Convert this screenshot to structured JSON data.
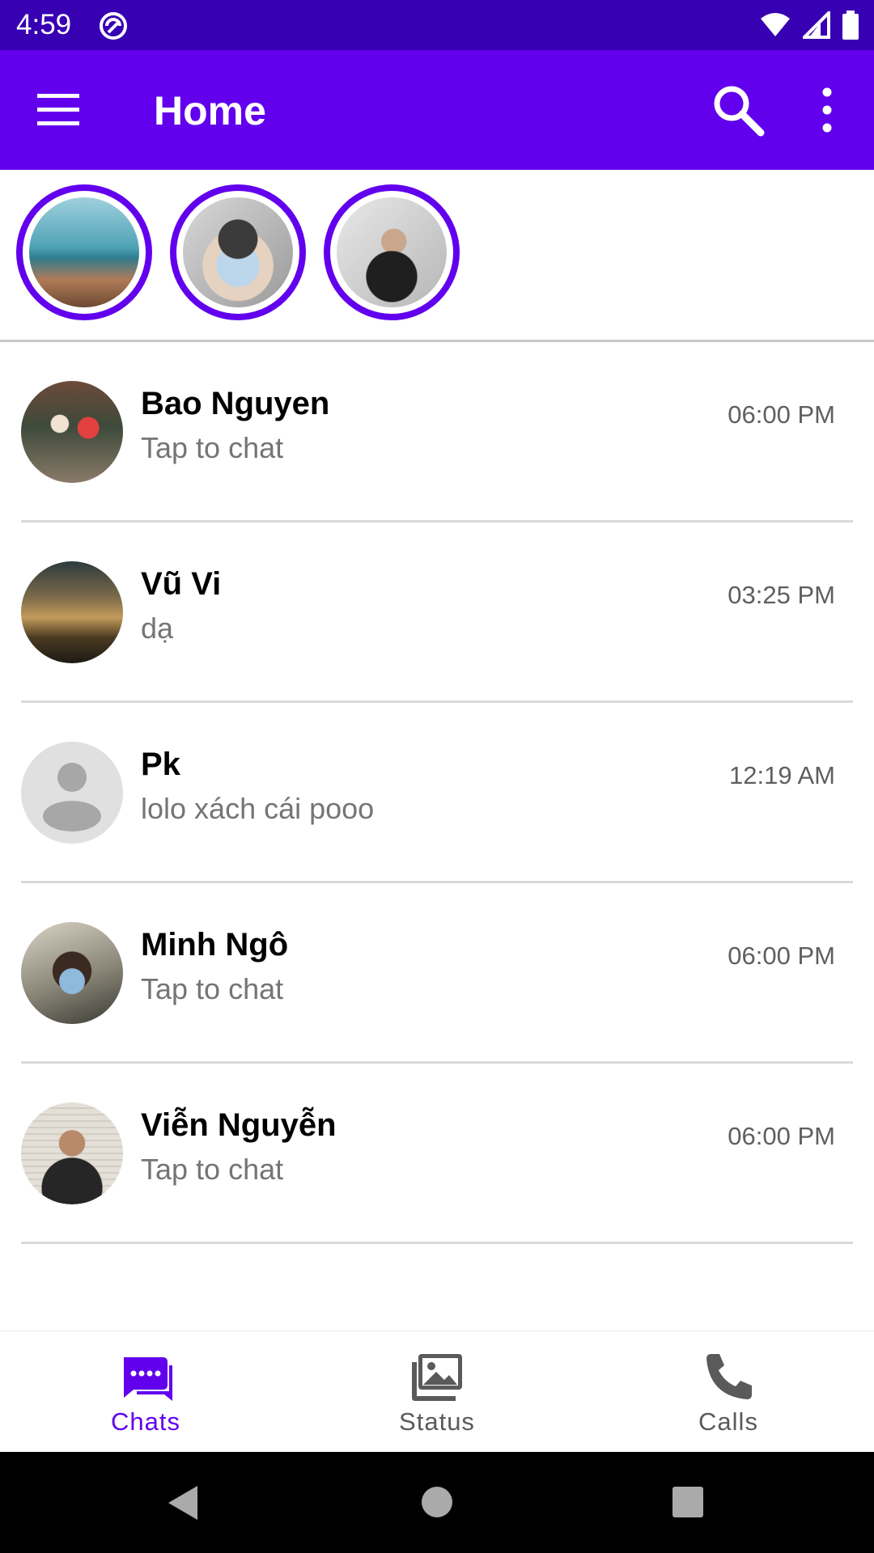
{
  "status_bar": {
    "time": "4:59"
  },
  "app_bar": {
    "title": "Home"
  },
  "stories": [
    "story-1",
    "story-2",
    "story-3"
  ],
  "chats": [
    {
      "name": "Bao Nguyen",
      "message": "Tap to chat",
      "time": "06:00 PM"
    },
    {
      "name": "Vũ Vi",
      "message": "dạ",
      "time": "03:25 PM"
    },
    {
      "name": "Pk",
      "message": "lolo xách cái pooo",
      "time": "12:19 AM"
    },
    {
      "name": "Minh Ngô",
      "message": "Tap to chat",
      "time": "06:00 PM"
    },
    {
      "name": "Viễn Nguyễn",
      "message": "Tap to chat",
      "time": "06:00 PM"
    }
  ],
  "bottom_nav": {
    "chats": "Chats",
    "status": "Status",
    "calls": "Calls"
  },
  "colors": {
    "primary": "#6200ee",
    "primary_dark": "#3700b3"
  }
}
